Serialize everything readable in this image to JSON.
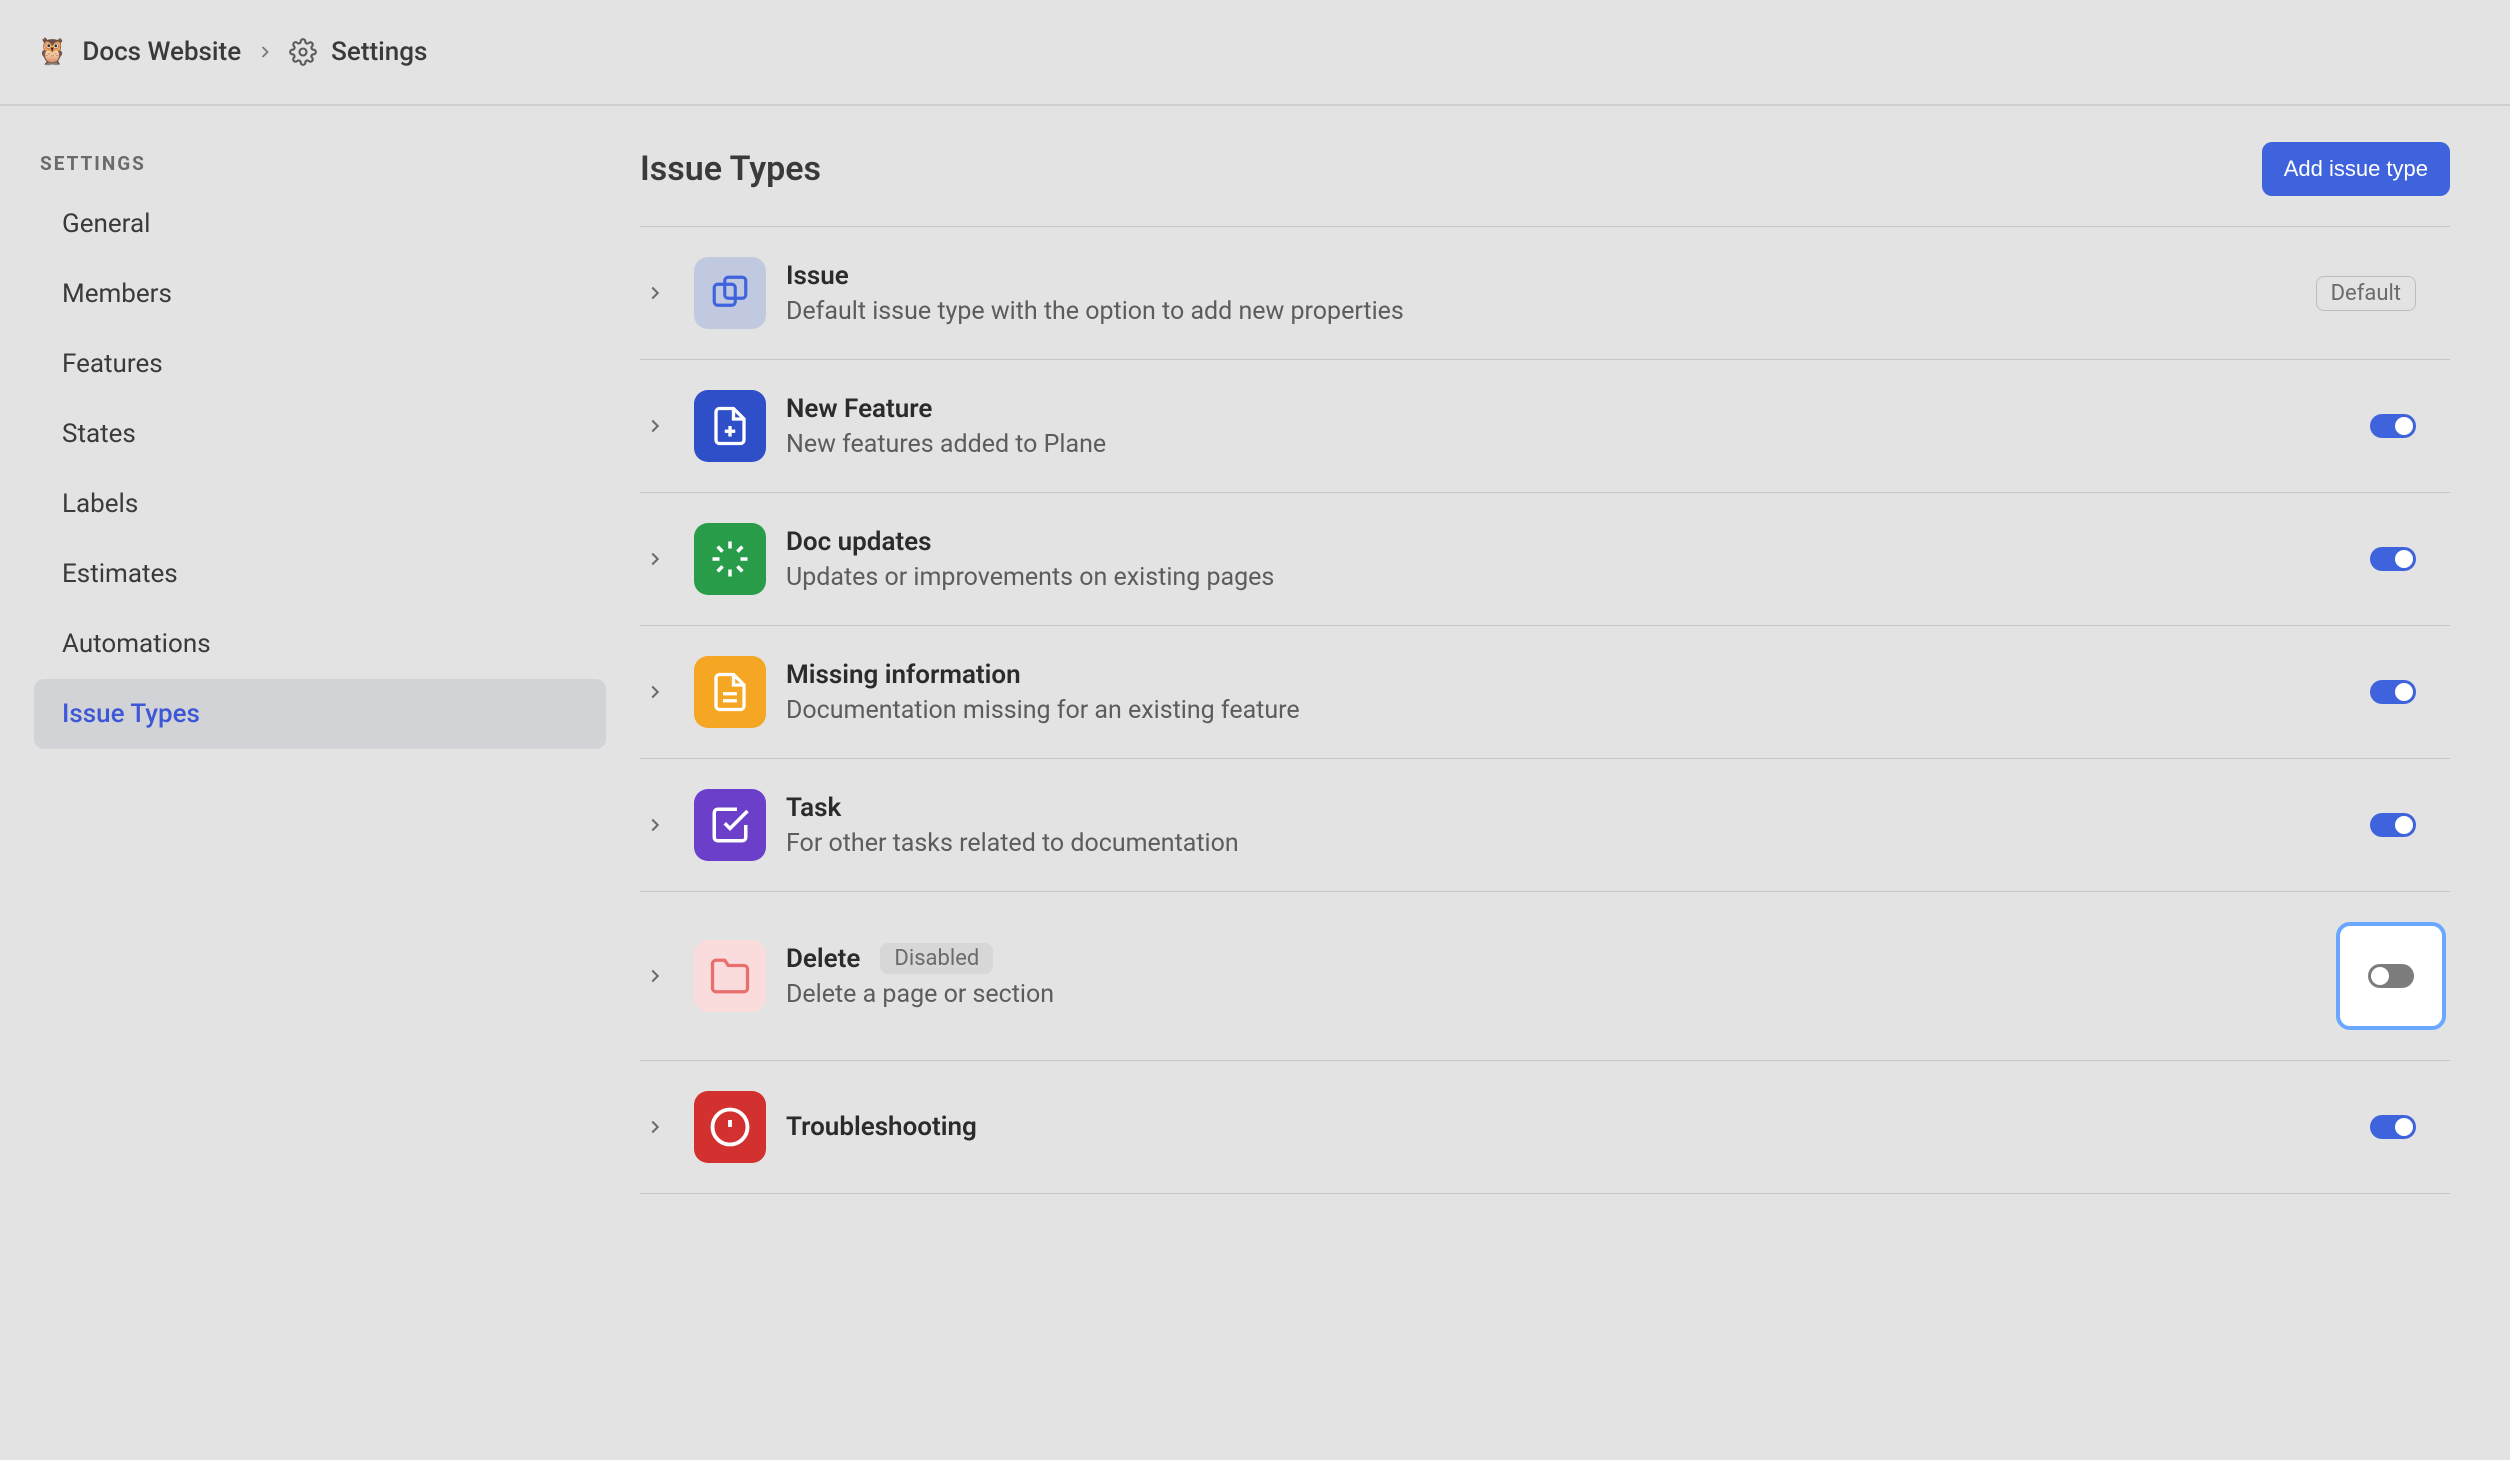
{
  "breadcrumb": {
    "project": "Docs Website",
    "page": "Settings"
  },
  "sidebar": {
    "title": "SETTINGS",
    "items": [
      {
        "label": "General"
      },
      {
        "label": "Members"
      },
      {
        "label": "Features"
      },
      {
        "label": "States"
      },
      {
        "label": "Labels"
      },
      {
        "label": "Estimates"
      },
      {
        "label": "Automations"
      },
      {
        "label": "Issue Types"
      }
    ]
  },
  "header": {
    "title": "Issue Types",
    "add_button": "Add issue type"
  },
  "badges": {
    "default": "Default",
    "disabled": "Disabled"
  },
  "types": [
    {
      "name": "Issue",
      "desc": "Default issue type with the option to add new properties"
    },
    {
      "name": "New Feature",
      "desc": "New features added to Plane"
    },
    {
      "name": "Doc updates",
      "desc": "Updates or improvements on existing pages"
    },
    {
      "name": "Missing information",
      "desc": "Documentation missing for an existing feature"
    },
    {
      "name": "Task",
      "desc": "For other tasks related to documentation"
    },
    {
      "name": "Delete",
      "desc": "Delete a page or section"
    },
    {
      "name": "Troubleshooting"
    }
  ]
}
